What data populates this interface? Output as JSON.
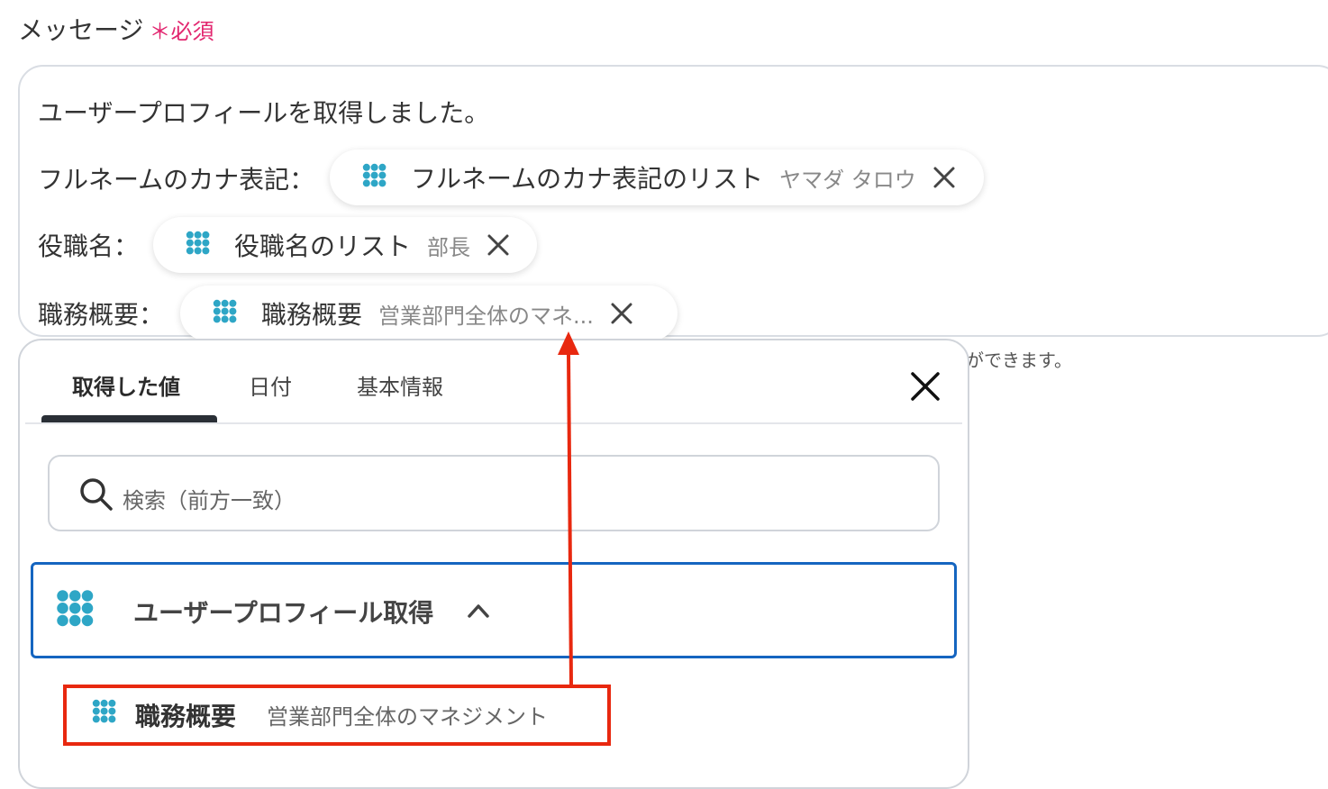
{
  "field": {
    "label": "メッセージ",
    "required_mark": "＊必須"
  },
  "message": {
    "intro": "ユーザープロフィールを取得しました。",
    "rows": [
      {
        "label": "フルネームのカナ表記：",
        "token_name": "フルネームのカナ表記のリスト",
        "token_value": "ヤマダ タロウ"
      },
      {
        "label": "役職名：",
        "token_name": "役職名のリスト",
        "token_value": "部長"
      },
      {
        "label": "職務概要：",
        "token_name": "職務概要",
        "token_value": "営業部門全体のマネ..."
      }
    ]
  },
  "hint_fragment": "ができます。",
  "panel": {
    "tabs": [
      "取得した値",
      "日付",
      "基本情報"
    ],
    "search_placeholder": "検索（前方一致）",
    "group_title": "ユーザープロフィール取得",
    "item": {
      "name": "職務概要",
      "value": "営業部門全体のマネジメント"
    }
  },
  "colors": {
    "accent": "#1565c0",
    "highlight": "#e8280f",
    "required": "#e2266f",
    "icon": "#2ea6c6"
  }
}
